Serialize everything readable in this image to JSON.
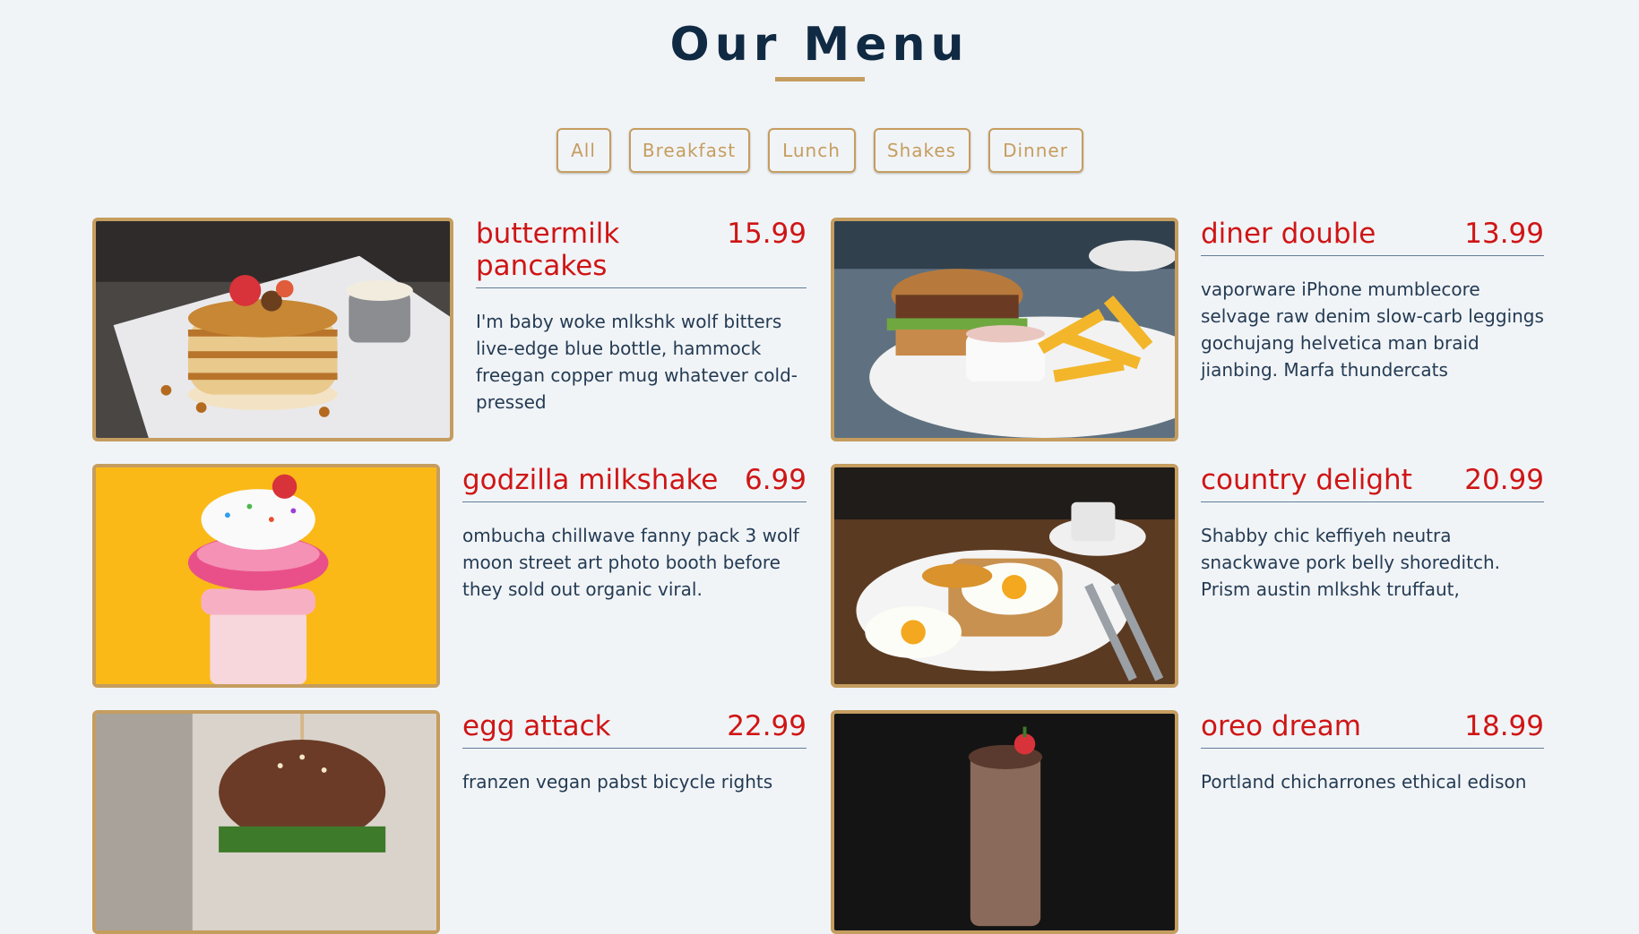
{
  "page": {
    "title": "Our Menu"
  },
  "filters": [
    "All",
    "Breakfast",
    "Lunch",
    "Shakes",
    "Dinner"
  ],
  "colors": {
    "accent": "#c59d5f",
    "price": "#cf1515",
    "heading": "#102a43",
    "background": "#f1f4f7"
  },
  "items": [
    {
      "name": "buttermilk pancakes",
      "price": "15.99",
      "image": "pancakes-photo",
      "desc": "I'm baby woke mlkshk wolf bitters live-edge blue bottle, hammock freegan copper mug whatever cold-pressed"
    },
    {
      "name": "diner double",
      "price": "13.99",
      "image": "burger-fries-photo",
      "desc": "vaporware iPhone mumblecore selvage raw denim slow-carb leggings gochujang helvetica man braid jianbing. Marfa thundercats"
    },
    {
      "name": "godzilla milkshake",
      "price": "6.99",
      "image": "milkshake-photo",
      "desc": "ombucha chillwave fanny pack 3 wolf moon street art photo booth before they sold out organic viral."
    },
    {
      "name": "country delight",
      "price": "20.99",
      "image": "eggs-toast-photo",
      "desc": "Shabby chic keffiyeh neutra snackwave pork belly shoreditch. Prism austin mlkshk truffaut,"
    },
    {
      "name": "egg attack",
      "price": "22.99",
      "image": "burger-photo",
      "desc": "franzen vegan pabst bicycle rights"
    },
    {
      "name": "oreo dream",
      "price": "18.99",
      "image": "oreo-shake-photo",
      "desc": "Portland chicharrones ethical edison"
    }
  ]
}
